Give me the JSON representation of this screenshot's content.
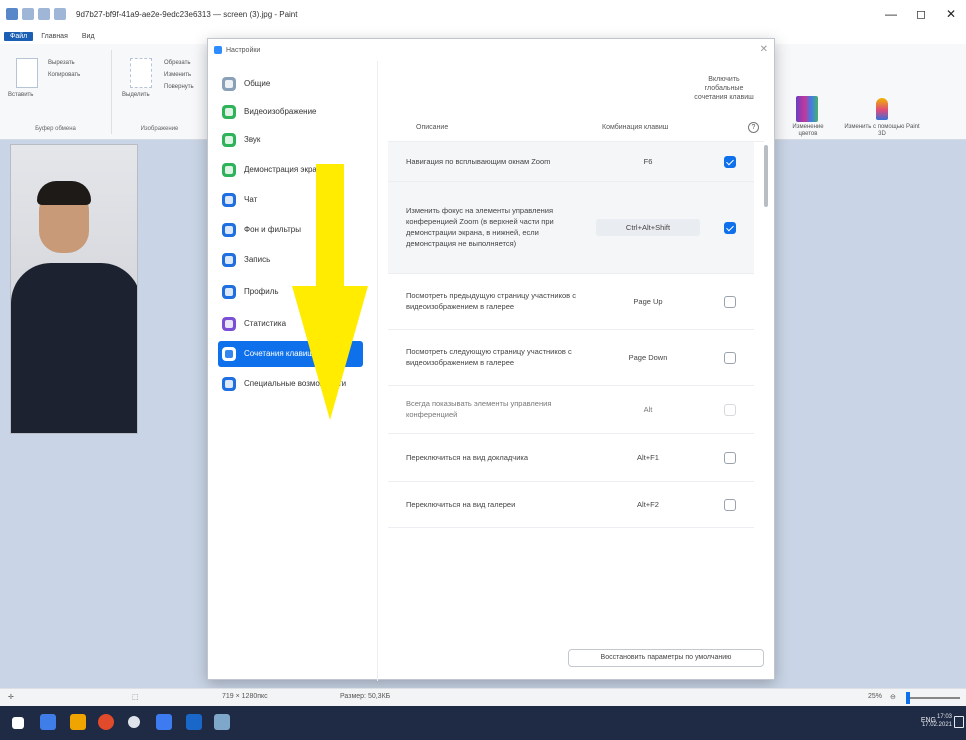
{
  "paint": {
    "title": "9d7b27-bf9f-41a9-ae2e-9edc23e6313 — screen (3).jpg - Paint",
    "menu_tabs": [
      "Файл",
      "Главная",
      "Вид"
    ],
    "ribbon": {
      "paste": "Вставить",
      "cut": "Вырезать",
      "copy": "Копировать",
      "clipboard_group": "Буфер обмена",
      "select": "Выделить",
      "crop": "Обрезать",
      "resize": "Изменить",
      "rotate": "Повернуть",
      "image_group": "Изображение",
      "edit_colors": "Изменение цветов",
      "paint3d": "Изменить с помощью Paint 3D"
    },
    "status": {
      "coords": "719 × 1280пкс",
      "size": "Размер: 50,3КБ",
      "zoom": "25%"
    }
  },
  "dialog": {
    "title": "Настройки",
    "sidebar": [
      {
        "label": "Общие",
        "color": "#8aa0b6",
        "active": false
      },
      {
        "label": "Видеоизображение",
        "color": "#2fb35a",
        "active": false
      },
      {
        "label": "Звук",
        "color": "#2fb35a",
        "active": false
      },
      {
        "label": "Демонстрация экрана",
        "color": "#2fb35a",
        "active": false
      },
      {
        "label": "Чат",
        "color": "#1f6fe0",
        "active": false
      },
      {
        "label": "Фон и фильтры",
        "color": "#1f6fe0",
        "active": false
      },
      {
        "label": "Запись",
        "color": "#1f6fe0",
        "active": false
      },
      {
        "label": "Профиль",
        "color": "#1f6fe0",
        "active": false
      },
      {
        "label": "Статистика",
        "color": "#7a4fd6",
        "active": false
      },
      {
        "label": "Сочетания клавиш",
        "color": "#ffffff",
        "active": true
      },
      {
        "label": "Специальные возможности",
        "color": "#1f6fe0",
        "active": false
      }
    ],
    "columns": {
      "description": "Описание",
      "shortcut": "Комбинация клавиш",
      "global": "Включить глобальные сочетания клавиш"
    },
    "shortcuts": [
      {
        "desc": "Навигация по всплывающим окнам Zoom",
        "key": "F6",
        "checked": true,
        "enabled": true
      },
      {
        "desc": "Изменить фокус на элементы управления конференцией Zoom (в верхней части при демонстрации экрана, в нижней, если демонстрация не выполняется)",
        "key": "Ctrl+Alt+Shift",
        "checked": true,
        "enabled": true
      },
      {
        "desc": "Посмотреть предыдущую страницу участников с видеоизображением в галерее",
        "key": "Page Up",
        "checked": false,
        "enabled": true
      },
      {
        "desc": "Посмотреть следующую страницу участников с видеоизображением в галерее",
        "key": "Page Down",
        "checked": false,
        "enabled": true
      },
      {
        "desc": "Всегда показывать элементы управления конференцией",
        "key": "Alt",
        "checked": false,
        "enabled": false
      },
      {
        "desc": "Переключиться на вид докладчика",
        "key": "Alt+F1",
        "checked": false,
        "enabled": true
      },
      {
        "desc": "Переключиться на вид галереи",
        "key": "Alt+F2",
        "checked": false,
        "enabled": true
      }
    ],
    "restore_button": "Восстановить параметры по умолчанию"
  },
  "taskbar": {
    "time": "17:03",
    "date": "17.02.2021",
    "lang": "ENG"
  },
  "colors": {
    "accent": "#0e71eb",
    "arrow": "#ffec00",
    "taskbar": "#1f2a44"
  }
}
